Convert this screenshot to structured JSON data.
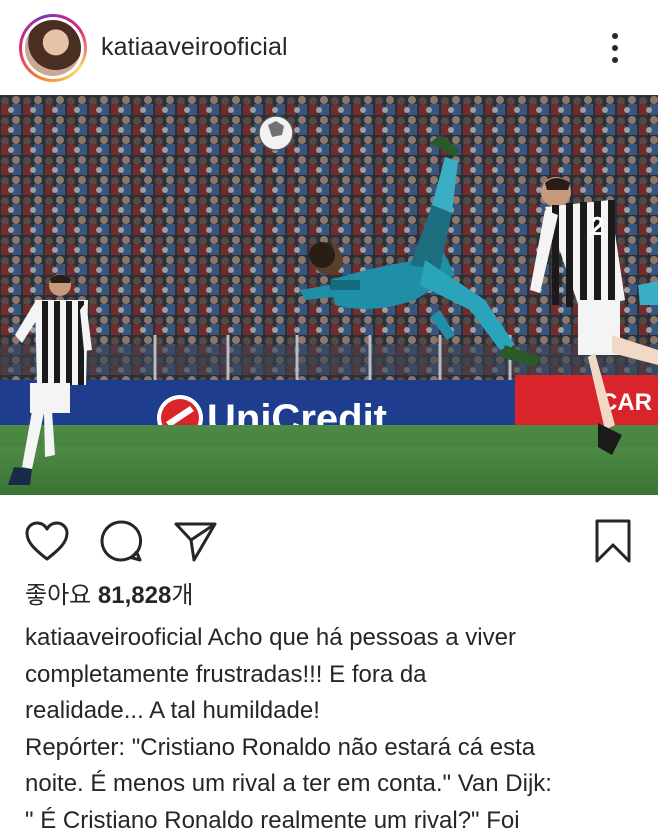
{
  "post": {
    "username": "katiaaveirooficial",
    "likes_label": "좋아요",
    "likes_count": "81,828",
    "likes_suffix": "개",
    "caption_username": "katiaaveirooficial",
    "caption_lines": [
      "Acho que há pessoas a viver",
      "completamente frustradas!!! E fora da",
      "realidade... A tal humildade!",
      "Repórter: \"Cristiano Ronaldo não estará cá esta",
      "noite. É menos um rival a ter em conta.\" Van Dijk:",
      "\" É Cristiano Ronaldo realmente um rival?\" Foi"
    ]
  },
  "photo": {
    "board_text": "UniCredit",
    "board_right_text": "CAR",
    "player_number": "2"
  },
  "icons": {
    "more": "more-options-icon",
    "like": "heart-icon",
    "comment": "comment-icon",
    "share": "paper-plane-icon",
    "save": "bookmark-icon"
  },
  "colors": {
    "text": "#262626",
    "board_blue": "#1e3d8f",
    "board_red": "#d9242b",
    "pitch": "#3f7d3a",
    "kit_teal": "#1e8fa6"
  }
}
